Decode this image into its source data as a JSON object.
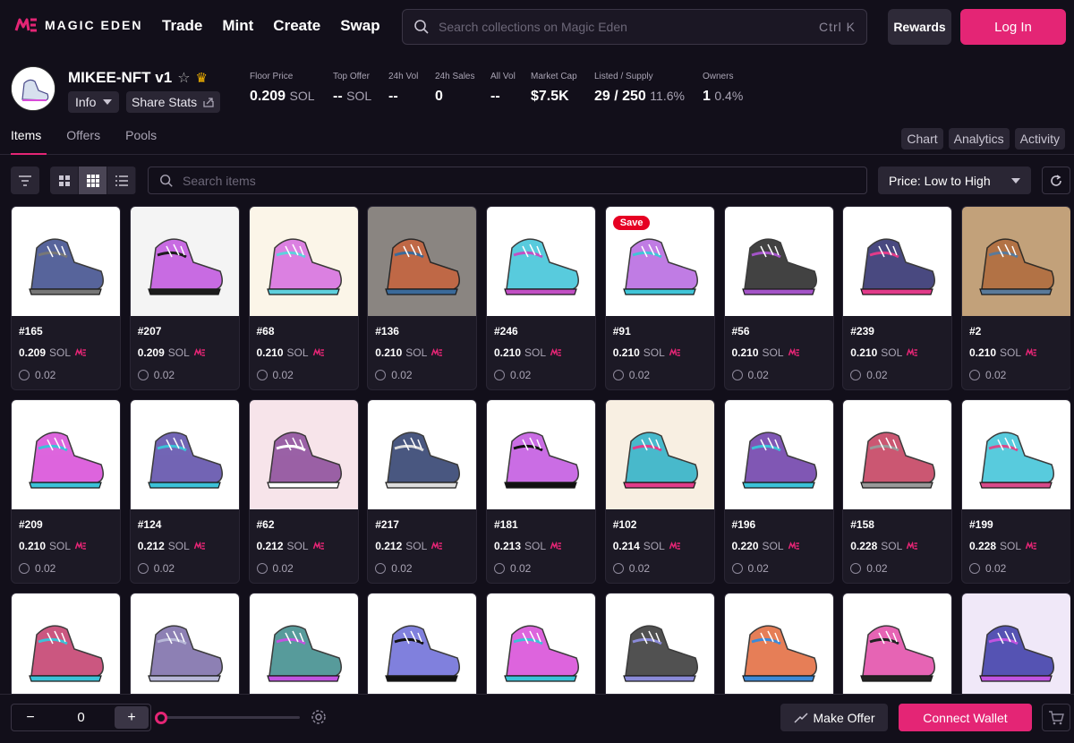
{
  "nav": {
    "logo_text": "MAGIC EDEN",
    "links": [
      "Trade",
      "Mint",
      "Create",
      "Swap"
    ],
    "search_placeholder": "Search collections on Magic Eden",
    "search_shortcut": "Ctrl K",
    "rewards_label": "Rewards",
    "login_label": "Log In"
  },
  "collection": {
    "name": "MIKEE-NFT v1",
    "info_label": "Info",
    "share_label": "Share Stats",
    "stats": [
      {
        "label": "Floor Price",
        "value": "0.209",
        "unit": "SOL"
      },
      {
        "label": "Top Offer",
        "value": "--",
        "unit": "SOL"
      },
      {
        "label": "24h Vol",
        "value": "--",
        "unit": ""
      },
      {
        "label": "24h Sales",
        "value": "0",
        "unit": ""
      },
      {
        "label": "All Vol",
        "value": "--",
        "unit": ""
      },
      {
        "label": "Market Cap",
        "value": "$7.5K",
        "unit": ""
      },
      {
        "label": "Listed / Supply",
        "value": "29 / 250",
        "unit": "11.6%"
      },
      {
        "label": "Owners",
        "value": "1",
        "unit": "0.4%"
      }
    ]
  },
  "tabs": {
    "left": [
      "Items",
      "Offers",
      "Pools"
    ],
    "active": "Items",
    "right": [
      "Chart",
      "Analytics",
      "Activity"
    ]
  },
  "toolbar": {
    "search_placeholder": "Search items",
    "sort_value": "Price: Low to High"
  },
  "items": [
    {
      "id": "#165",
      "price": "0.209",
      "unit": "SOL",
      "fee": "0.02",
      "bg": "#ffffff",
      "c1": "#3a4a8a",
      "c2": "#777777"
    },
    {
      "id": "#207",
      "price": "0.209",
      "unit": "SOL",
      "fee": "0.02",
      "bg": "#f4f4f4",
      "c1": "#c154e0",
      "c2": "#1c1c1c"
    },
    {
      "id": "#68",
      "price": "0.210",
      "unit": "SOL",
      "fee": "0.02",
      "bg": "#fbf5e8",
      "c1": "#d66ce0",
      "c2": "#5fd0dd"
    },
    {
      "id": "#136",
      "price": "0.210",
      "unit": "SOL",
      "fee": "0.02",
      "bg": "#8a8581",
      "c1": "#c9643c",
      "c2": "#3a6a9a"
    },
    {
      "id": "#246",
      "price": "0.210",
      "unit": "SOL",
      "fee": "0.02",
      "bg": "#ffffff",
      "c1": "#3bc2d8",
      "c2": "#c24fc4"
    },
    {
      "id": "#91",
      "price": "0.210",
      "unit": "SOL",
      "fee": "0.02",
      "bg": "#ffffff",
      "c1": "#b666e0",
      "c2": "#40c5d8",
      "save": "Save"
    },
    {
      "id": "#56",
      "price": "0.210",
      "unit": "SOL",
      "fee": "0.02",
      "bg": "#ffffff",
      "c1": "#222222",
      "c2": "#a454c8"
    },
    {
      "id": "#239",
      "price": "0.210",
      "unit": "SOL",
      "fee": "0.02",
      "bg": "#ffffff",
      "c1": "#2a2a6a",
      "c2": "#e23b8a"
    },
    {
      "id": "#2",
      "price": "0.210",
      "unit": "SOL",
      "fee": "0.02",
      "bg": "#c2a17a",
      "c1": "#b06a3c",
      "c2": "#5a7a9a"
    },
    {
      "id": "#209",
      "price": "0.210",
      "unit": "SOL",
      "fee": "0.02",
      "bg": "#ffffff",
      "c1": "#d84ad8",
      "c2": "#3bc2d8"
    },
    {
      "id": "#124",
      "price": "0.212",
      "unit": "SOL",
      "fee": "0.02",
      "bg": "#ffffff",
      "c1": "#5a4aa8",
      "c2": "#3bc2d8"
    },
    {
      "id": "#62",
      "price": "0.212",
      "unit": "SOL",
      "fee": "0.02",
      "bg": "#f7e4ea",
      "c1": "#8a4a9a",
      "c2": "#ffffff"
    },
    {
      "id": "#217",
      "price": "0.212",
      "unit": "SOL",
      "fee": "0.02",
      "bg": "#ffffff",
      "c1": "#2a3a6a",
      "c2": "#dddddd"
    },
    {
      "id": "#181",
      "price": "0.213",
      "unit": "SOL",
      "fee": "0.02",
      "bg": "#ffffff",
      "c1": "#c154e0",
      "c2": "#111111"
    },
    {
      "id": "#102",
      "price": "0.214",
      "unit": "SOL",
      "fee": "0.02",
      "bg": "#f8efe2",
      "c1": "#2ab0c8",
      "c2": "#e23b8a"
    },
    {
      "id": "#196",
      "price": "0.220",
      "unit": "SOL",
      "fee": "0.02",
      "bg": "#ffffff",
      "c1": "#6a3aa8",
      "c2": "#3bc2d8"
    },
    {
      "id": "#158",
      "price": "0.228",
      "unit": "SOL",
      "fee": "0.02",
      "bg": "#ffffff",
      "c1": "#c23a5a",
      "c2": "#999999"
    },
    {
      "id": "#199",
      "price": "0.228",
      "unit": "SOL",
      "fee": "0.02",
      "bg": "#ffffff",
      "c1": "#3bc2d8",
      "c2": "#d84a8a"
    },
    {
      "bg": "#ffffff",
      "c1": "#c23a6a",
      "c2": "#3bc2d8"
    },
    {
      "bg": "#ffffff",
      "c1": "#7a6aa8",
      "c2": "#b8b8d8"
    },
    {
      "bg": "#ffffff",
      "c1": "#3a8a8a",
      "c2": "#c154e0"
    },
    {
      "bg": "#ffffff",
      "c1": "#6a6ad8",
      "c2": "#111111"
    },
    {
      "bg": "#ffffff",
      "c1": "#d84ad8",
      "c2": "#3bc2d8"
    },
    {
      "bg": "#ffffff",
      "c1": "#333333",
      "c2": "#8a8ad8"
    },
    {
      "bg": "#ffffff",
      "c1": "#e2683a",
      "c2": "#3b8ad8"
    },
    {
      "bg": "#ffffff",
      "c1": "#e24aa8",
      "c2": "#222222"
    },
    {
      "bg": "#f0e8f8",
      "c1": "#3a3aa8",
      "c2": "#c154e0"
    }
  ],
  "bottom": {
    "quantity": "0",
    "make_offer_label": "Make Offer",
    "connect_wallet_label": "Connect Wallet"
  },
  "colors": {
    "accent": "#e42575",
    "background": "#120f1a",
    "card": "#1c1925"
  }
}
